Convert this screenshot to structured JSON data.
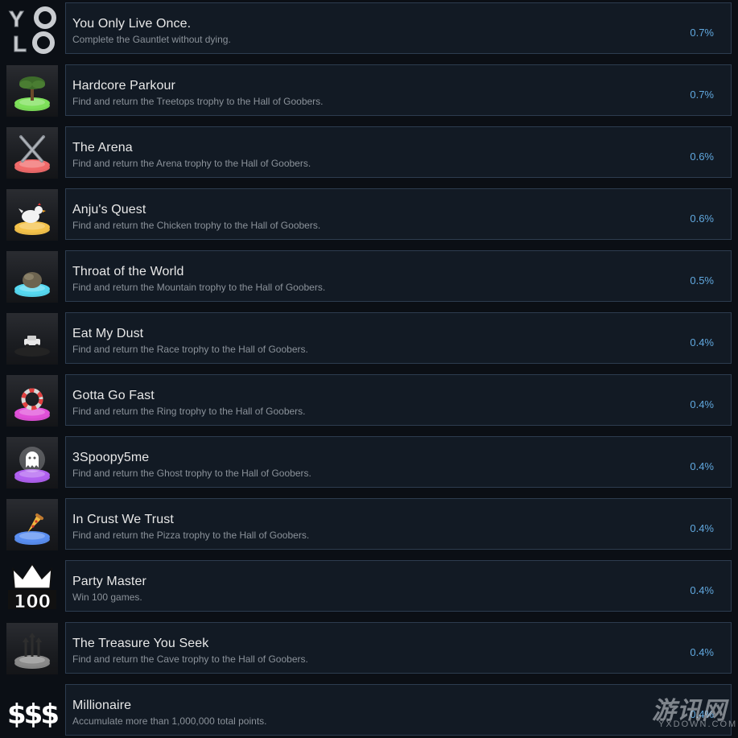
{
  "achievements": [
    {
      "title": "You Only Live Once.",
      "description": "Complete the Gauntlet without dying.",
      "percent": "0.7%",
      "icon": "yolo-icon"
    },
    {
      "title": "Hardcore Parkour",
      "description": "Find and return the Treetops trophy to the Hall of Goobers.",
      "percent": "0.7%",
      "icon": "treetops-trophy-icon",
      "pedestal_color": "#7ee05a"
    },
    {
      "title": "The Arena",
      "description": "Find and return the Arena trophy to the Hall of Goobers.",
      "percent": "0.6%",
      "icon": "arena-trophy-icon",
      "pedestal_color": "#f06a6a"
    },
    {
      "title": "Anju's Quest",
      "description": "Find and return the Chicken trophy to the Hall of Goobers.",
      "percent": "0.6%",
      "icon": "chicken-trophy-icon",
      "pedestal_color": "#f4c24a"
    },
    {
      "title": "Throat of the World",
      "description": "Find and return the Mountain trophy to the Hall of Goobers.",
      "percent": "0.5%",
      "icon": "mountain-trophy-icon",
      "pedestal_color": "#56d8f0"
    },
    {
      "title": "Eat My Dust",
      "description": "Find and return the Race trophy to the Hall of Goobers.",
      "percent": "0.4%",
      "icon": "race-trophy-icon",
      "pedestal_color": "#2a2a2a"
    },
    {
      "title": "Gotta Go Fast",
      "description": "Find and return the Ring trophy to the Hall of Goobers.",
      "percent": "0.4%",
      "icon": "ring-trophy-icon",
      "pedestal_color": "#e050d8"
    },
    {
      "title": "3Spoopy5me",
      "description": "Find and return the Ghost trophy to the Hall of Goobers.",
      "percent": "0.4%",
      "icon": "ghost-trophy-icon",
      "pedestal_color": "#b060f0"
    },
    {
      "title": "In Crust We Trust",
      "description": "Find and return the Pizza trophy to the Hall of Goobers.",
      "percent": "0.4%",
      "icon": "pizza-trophy-icon",
      "pedestal_color": "#5a8ef0"
    },
    {
      "title": "Party Master",
      "description": "Win 100 games.",
      "percent": "0.4%",
      "icon": "crown-100-icon",
      "icon_text": "100"
    },
    {
      "title": "The Treasure You Seek",
      "description": "Find and return the Cave trophy to the Hall of Goobers.",
      "percent": "0.4%",
      "icon": "cave-trophy-icon",
      "pedestal_color": "#8a8a8a"
    },
    {
      "title": "Millionaire",
      "description": "Accumulate more than 1,000,000 total points.",
      "percent": "0.4%",
      "icon": "dollar-signs-icon",
      "icon_text": "$$$"
    }
  ],
  "watermark": {
    "text": "游讯网",
    "subtext": "YXDOWN.COM"
  }
}
